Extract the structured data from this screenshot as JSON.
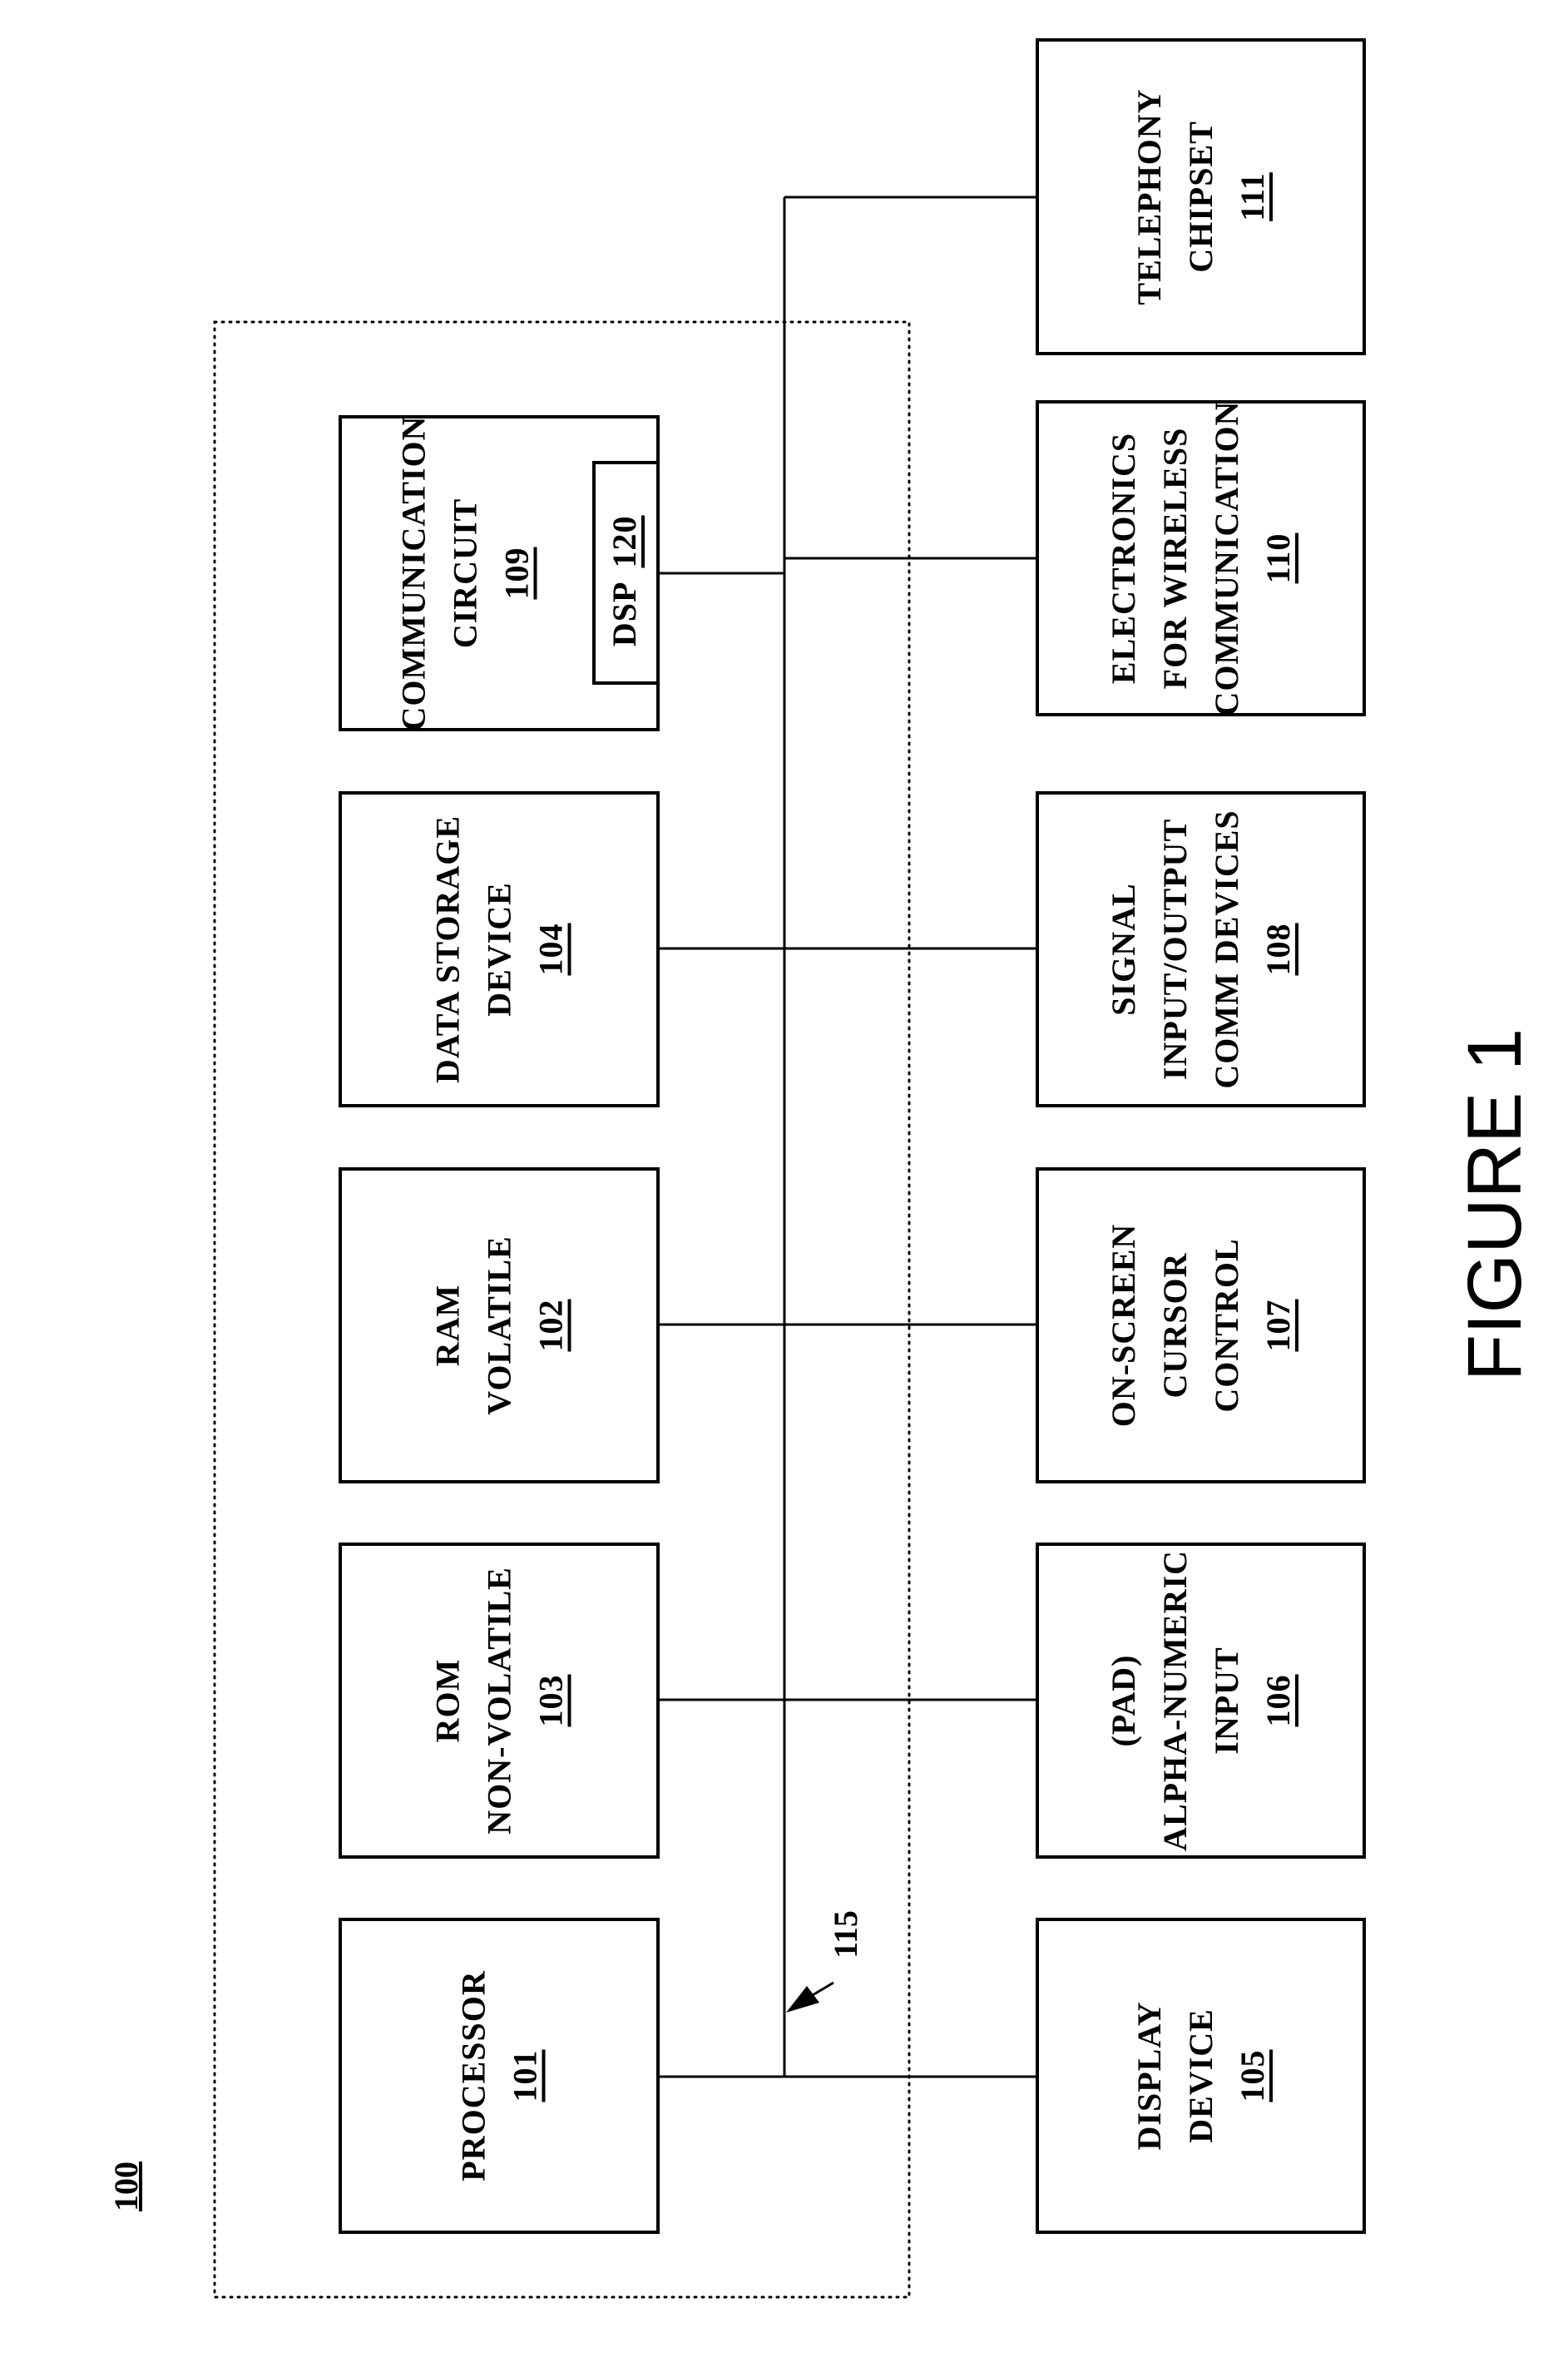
{
  "figure": {
    "caption": "FIGURE 1",
    "system_ref": "100",
    "bus_ref": "115",
    "ink_color": "#000000",
    "background_color": "#ffffff"
  },
  "inner_components": [
    {
      "id": "processor",
      "lines": [
        "PROCESSOR"
      ],
      "ref": "101"
    },
    {
      "id": "rom",
      "lines": [
        "ROM",
        "NON-VOLATILE"
      ],
      "ref": "103"
    },
    {
      "id": "ram",
      "lines": [
        "RAM",
        "VOLATILE"
      ],
      "ref": "102"
    },
    {
      "id": "data-storage",
      "lines": [
        "DATA STORAGE",
        "DEVICE"
      ],
      "ref": "104"
    },
    {
      "id": "communication-circuit",
      "lines": [
        "COMMUNICATION",
        "CIRCUIT"
      ],
      "ref": "109",
      "sub": {
        "id": "dsp",
        "label": "DSP",
        "ref": "120"
      }
    }
  ],
  "outer_components": [
    {
      "id": "display-device",
      "lines": [
        "DISPLAY",
        "DEVICE"
      ],
      "ref": "105"
    },
    {
      "id": "alpha-numeric-input",
      "lines": [
        "(PAD)",
        "ALPHA-NUMERIC",
        "INPUT"
      ],
      "ref": "106"
    },
    {
      "id": "cursor-control",
      "lines": [
        "ON-SCREEN",
        "CURSOR",
        "CONTROL"
      ],
      "ref": "107"
    },
    {
      "id": "signal-io",
      "lines": [
        "SIGNAL",
        "INPUT/OUTPUT",
        "COMM DEVICES"
      ],
      "ref": "108"
    },
    {
      "id": "wireless-electronics",
      "lines": [
        "ELECTRONICS",
        "FOR WIRELESS",
        "COMMUNICATION"
      ],
      "ref": "110"
    },
    {
      "id": "telephony-chipset",
      "lines": [
        "TELEPHONY",
        "CHIPSET"
      ],
      "ref": "111"
    }
  ]
}
